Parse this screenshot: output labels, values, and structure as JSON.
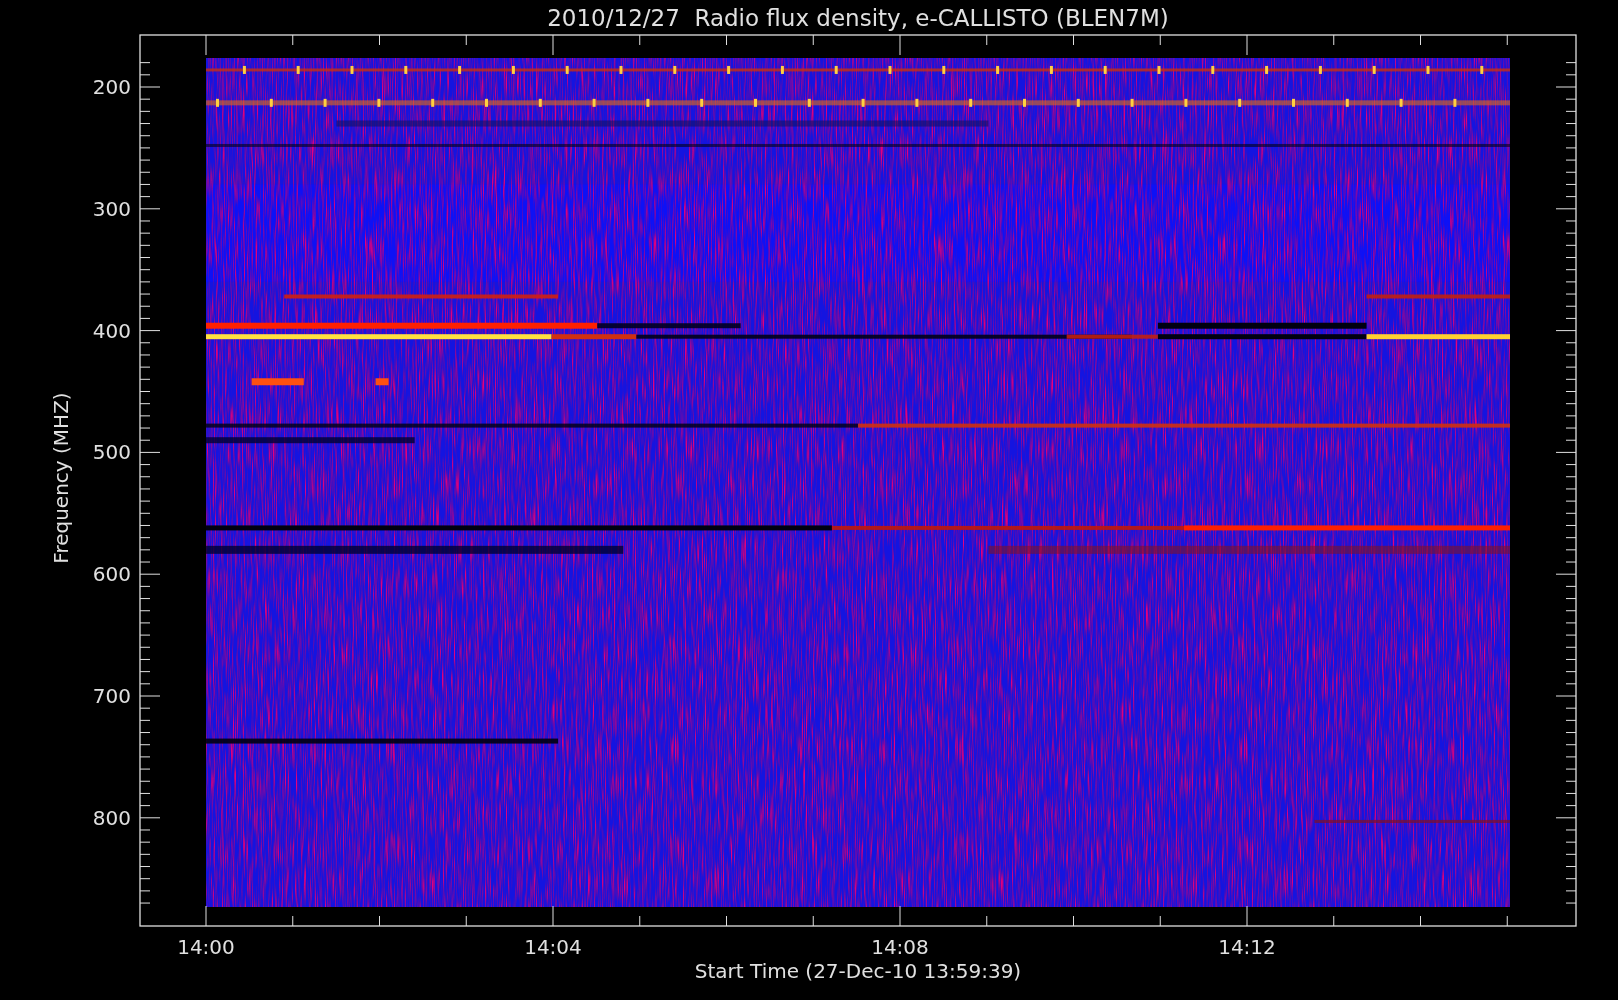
{
  "title": "2010/12/27  Radio flux density, e-CALLISTO (BLEN7M)",
  "y_axis": {
    "label": "Frequency (MHZ)",
    "ticks": [
      "200",
      "300",
      "400",
      "500",
      "600",
      "700",
      "800"
    ]
  },
  "x_axis": {
    "label": "Start Time (27-Dec-10 13:59:39)",
    "ticks": [
      "14:00",
      "14:04",
      "14:08",
      "14:12"
    ]
  }
}
